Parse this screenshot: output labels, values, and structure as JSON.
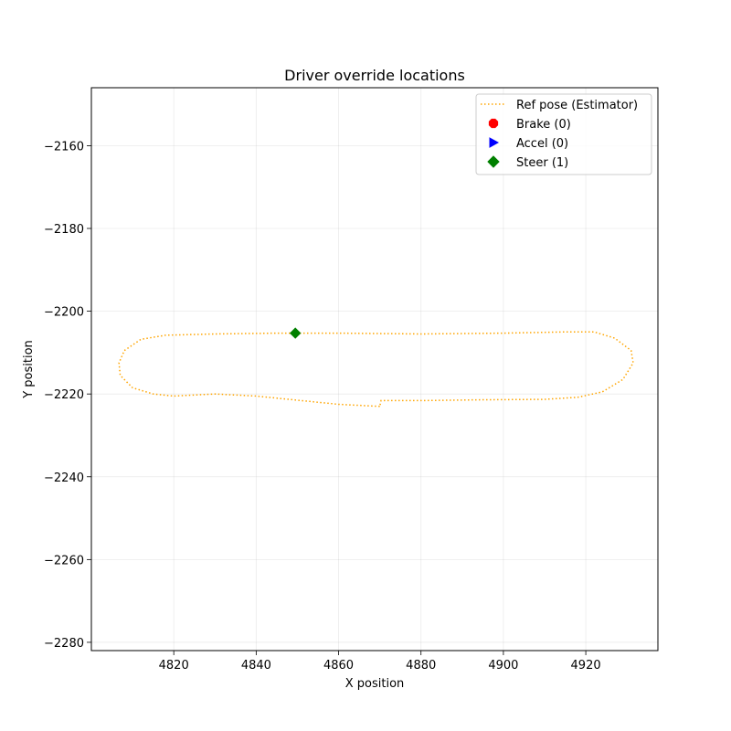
{
  "chart_data": {
    "type": "scatter",
    "title": "Driver override locations",
    "xlabel": "X position",
    "ylabel": "Y position",
    "xlim": [
      4800.0,
      4937.5
    ],
    "ylim": [
      -2282.0,
      -2146.0
    ],
    "xticks": [
      4820,
      4840,
      4860,
      4880,
      4900,
      4920
    ],
    "yticks": [
      -2160,
      -2180,
      -2200,
      -2220,
      -2240,
      -2260,
      -2280
    ],
    "xtick_labels": [
      "4820",
      "4840",
      "4860",
      "4880",
      "4900",
      "4920"
    ],
    "ytick_labels": [
      "−2160",
      "−2180",
      "−2200",
      "−2220",
      "−2240",
      "−2260",
      "−2280"
    ],
    "grid": true,
    "legend_position": "upper right",
    "series": [
      {
        "name": "Ref pose (Estimator)",
        "kind": "line",
        "style": "dotted",
        "color": "#ffa500",
        "x": [
          4870,
          4860,
          4850,
          4840,
          4830,
          4820,
          4815,
          4810,
          4807,
          4806.7,
          4808,
          4812,
          4818,
          4830,
          4845,
          4860,
          4880,
          4900,
          4915,
          4922,
          4927,
          4931,
          4931.5,
          4929,
          4924,
          4918,
          4910,
          4895,
          4880,
          4870.3,
          4870
        ],
        "y": [
          -2223,
          -2222.5,
          -2221.5,
          -2220.5,
          -2220,
          -2220.5,
          -2220,
          -2218.5,
          -2215.5,
          -2212.5,
          -2209.5,
          -2206.8,
          -2205.8,
          -2205.5,
          -2205.3,
          -2205.3,
          -2205.5,
          -2205.3,
          -2205,
          -2205,
          -2206.5,
          -2209.5,
          -2212.5,
          -2216.5,
          -2219.5,
          -2220.8,
          -2221.3,
          -2221.4,
          -2221.6,
          -2221.6,
          -2223
        ]
      },
      {
        "name": "Brake (0)",
        "kind": "marker",
        "marker": "octagon",
        "color": "#ff0000",
        "x": [],
        "y": []
      },
      {
        "name": "Accel (0)",
        "kind": "marker",
        "marker": "triangle-right",
        "color": "#0000ff",
        "x": [],
        "y": []
      },
      {
        "name": "Steer (1)",
        "kind": "marker",
        "marker": "diamond",
        "color": "#008000",
        "x": [
          4849.5
        ],
        "y": [
          -2205.3
        ]
      }
    ]
  }
}
